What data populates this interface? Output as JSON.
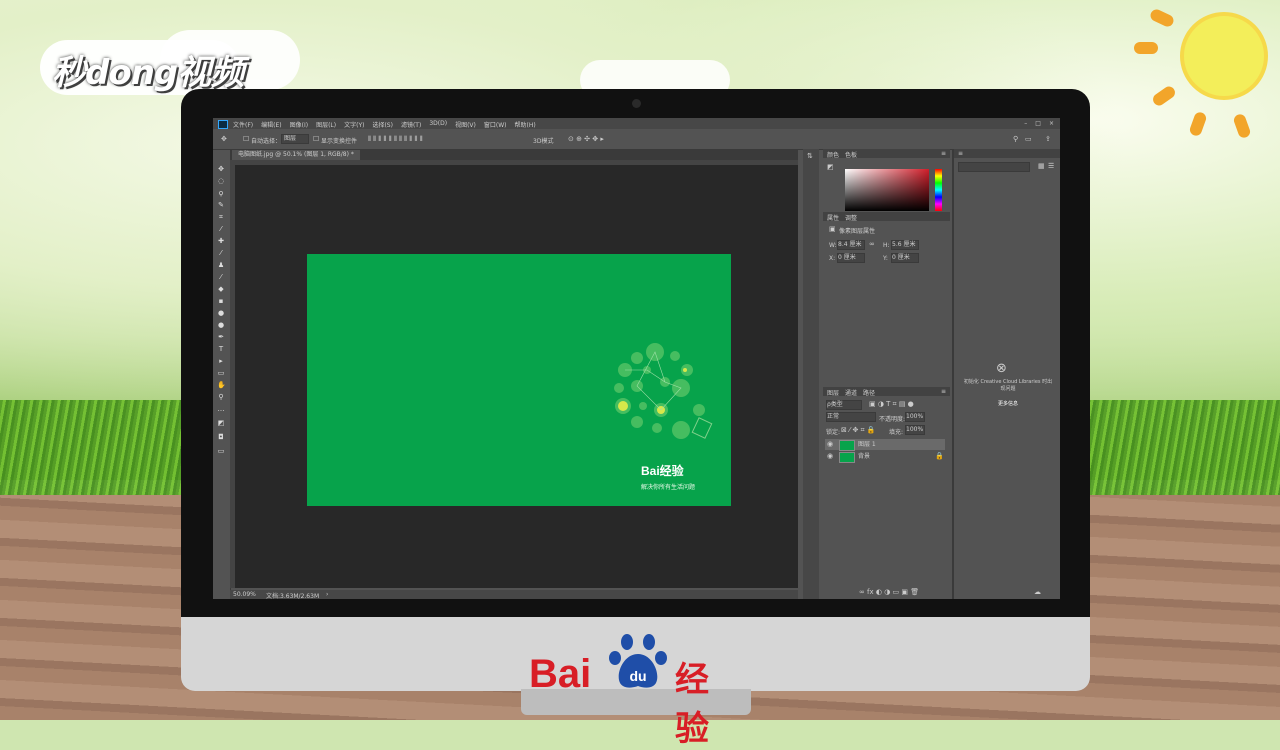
{
  "watermark": {
    "top_left_logo": "秒dong视频"
  },
  "ps": {
    "menu": [
      "文件(F)",
      "编辑(E)",
      "图像(I)",
      "图层(L)",
      "文字(Y)",
      "选择(S)",
      "滤镜(T)",
      "3D(D)",
      "视图(V)",
      "窗口(W)",
      "帮助(H)"
    ],
    "options": {
      "auto_select": "自动选择：",
      "layer_select": "图层",
      "show_transform": "显示变换控件",
      "mode_3d": "3D模式"
    },
    "doc_tab": "电脑图纸.jpg @ 50.1% (图层 1, RGB/8) *",
    "doc": {
      "brand": "Bai经验",
      "slogan": "解决你所有生活问题"
    },
    "status": {
      "zoom": "50.09%",
      "doc_size": "文档:3.63M/2.63M"
    },
    "color_panel": {
      "tab1": "颜色",
      "tab2": "色板"
    },
    "properties": {
      "tab1": "属性",
      "tab2": "调整",
      "title": "像素图层属性",
      "w_label": "W:",
      "w_value": "8.4 厘米",
      "h_label": "H:",
      "h_value": "5.6 厘米",
      "x_label": "X:",
      "x_value": "0 厘米",
      "y_label": "Y:",
      "y_value": "0 厘米"
    },
    "layers": {
      "tab1": "图层",
      "tab2": "通道",
      "tab3": "路径",
      "kind": "ρ类型",
      "blend": "正常",
      "opacity_label": "不透明度:",
      "opacity": "100%",
      "lock_label": "锁定:",
      "fill_label": "填充:",
      "fill": "100%",
      "items": [
        {
          "name": "图层 1"
        },
        {
          "name": "背景"
        }
      ]
    },
    "libraries": {
      "message": "初始化 Creative Cloud Libraries 时出现问题",
      "more": "更多信息"
    }
  },
  "footer": {
    "bai": "Bai",
    "jy": "经验"
  },
  "colors": {
    "doc_green": "#07a34b",
    "baidu_red": "#d81e26"
  }
}
